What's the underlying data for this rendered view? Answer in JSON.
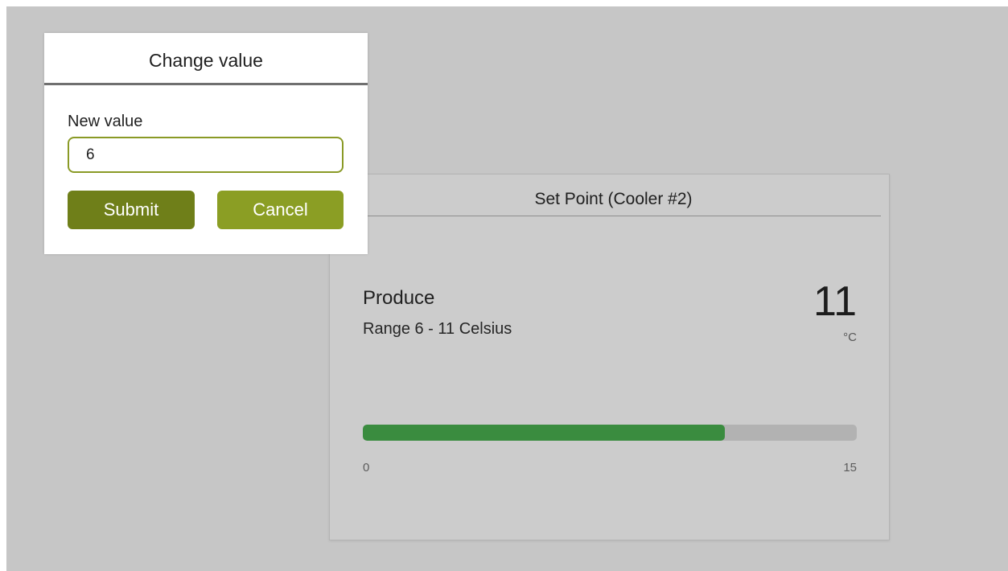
{
  "widget": {
    "title": "Set Point (Cooler #2)",
    "item_name": "Produce",
    "range_text": "Range 6 - 11 Celsius",
    "reading": "11",
    "unit": "°C",
    "bar": {
      "min_label": "0",
      "max_label": "15",
      "min": 0,
      "max": 15,
      "value": 11,
      "fill_color": "#3a8c3f",
      "track_color": "#b2b2b2"
    }
  },
  "dialog": {
    "title": "Change value",
    "field_label": "New value",
    "input_value": "6",
    "submit_label": "Submit",
    "cancel_label": "Cancel",
    "accent_color": "#8a9a26"
  }
}
